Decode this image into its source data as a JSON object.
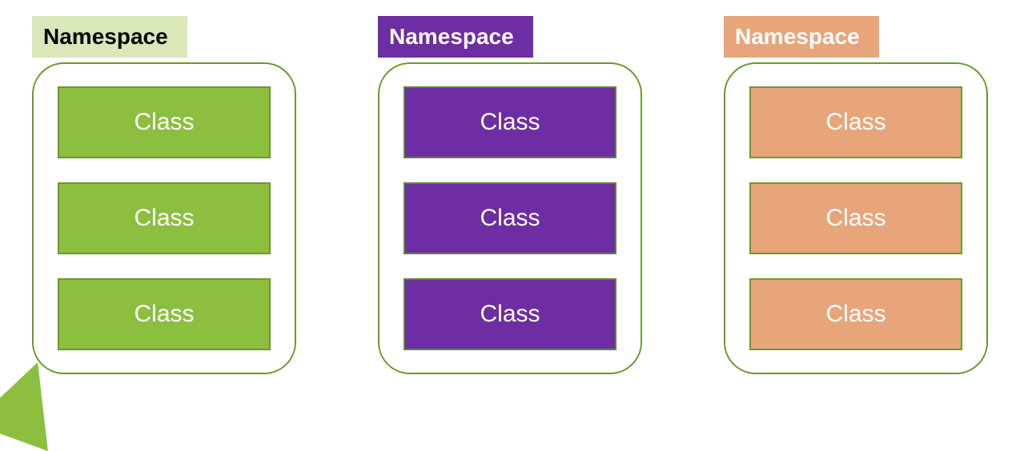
{
  "namespaces": [
    {
      "header_label": "Namespace",
      "color_scheme": "green",
      "header_bg": "#d8e8b9",
      "header_text_color": "#000000",
      "class_bg": "#8cbf3f",
      "classes": [
        "Class",
        "Class",
        "Class"
      ]
    },
    {
      "header_label": "Namespace",
      "color_scheme": "purple",
      "header_bg": "#6e2da3",
      "header_text_color": "#ffffff",
      "class_bg": "#6e2da3",
      "classes": [
        "Class",
        "Class",
        "Class"
      ]
    },
    {
      "header_label": "Namespace",
      "color_scheme": "orange",
      "header_bg": "#e8a57a",
      "header_text_color": "#ffffff",
      "class_bg": "#e8a57a",
      "classes": [
        "Class",
        "Class",
        "Class"
      ]
    }
  ],
  "container_border_color": "#6a9a2a"
}
